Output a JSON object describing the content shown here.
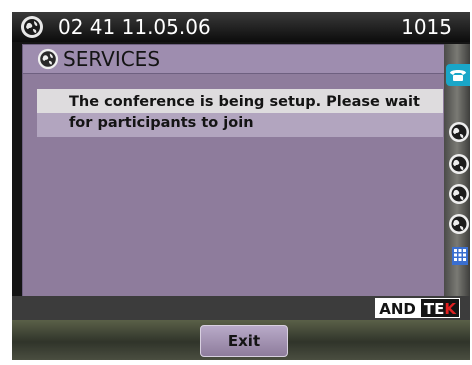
{
  "status_bar": {
    "datetime": "02 41 11.05.06",
    "extension": "1015"
  },
  "services": {
    "title": "SERVICES",
    "message": "The conference is being setup. Please wait for participants to join"
  },
  "right_column": {
    "tab_icon": "phone-icon",
    "buttons": [
      "globe-icon",
      "globe-icon",
      "globe-icon",
      "globe-icon",
      "keypad-icon"
    ]
  },
  "brand": {
    "part1": "AND",
    "part2": "TE",
    "part3": "K"
  },
  "softkeys": {
    "exit_label": "Exit"
  },
  "colors": {
    "panel": "#8e7c9c",
    "message_bg": "#dedcde",
    "tab_accent": "#1aa6c8",
    "brand_red": "#e02020"
  }
}
